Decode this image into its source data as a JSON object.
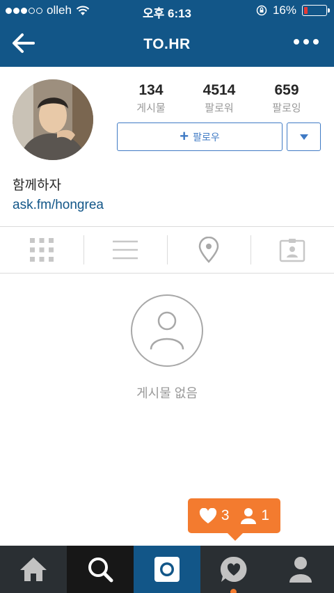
{
  "status_bar": {
    "carrier": "olleh",
    "time": "오후 6:13",
    "battery": "16%",
    "battery_level": 0.16,
    "signal_bars_filled": 3,
    "signal_bars_total": 5
  },
  "nav": {
    "title": "TO.HR",
    "back_icon": "back-arrow-icon",
    "more_icon": "more-dots-icon"
  },
  "profile": {
    "stats": [
      {
        "value": "134",
        "label": "게시물"
      },
      {
        "value": "4514",
        "label": "팔로워"
      },
      {
        "value": "659",
        "label": "팔로잉"
      }
    ],
    "follow_label": "팔로우",
    "bio": "함께하자",
    "link": "ask.fm/hongrea"
  },
  "tabs": [
    "grid-icon",
    "list-icon",
    "location-pin-icon",
    "tagged-photos-icon"
  ],
  "empty_state": {
    "text": "게시물 없음"
  },
  "notification": {
    "likes": "3",
    "follows": "1"
  },
  "bottom_nav": [
    "home-icon",
    "search-icon",
    "camera-icon",
    "activity-icon",
    "profile-icon"
  ],
  "colors": {
    "brand": "#125688",
    "accent": "#3f7ac4",
    "notification": "#f37b2f",
    "battery_low": "#e53935"
  }
}
